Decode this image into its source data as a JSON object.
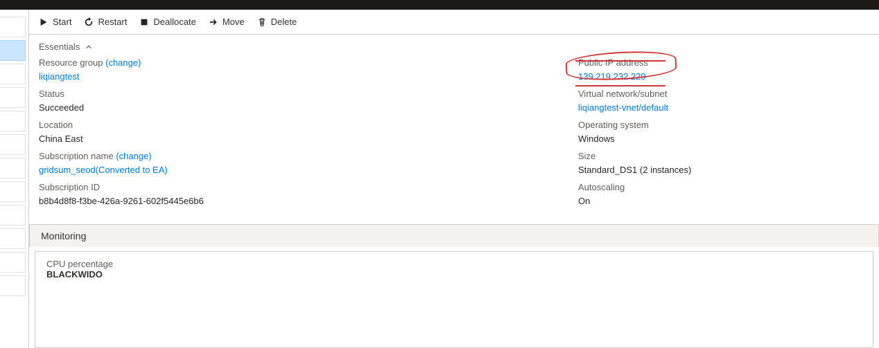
{
  "toolbar": {
    "start": "Start",
    "restart": "Restart",
    "deallocate": "Deallocate",
    "move": "Move",
    "delete": "Delete"
  },
  "essentials": {
    "header": "Essentials",
    "left": {
      "resource_group_label": "Resource group",
      "resource_group_change": "(change)",
      "resource_group_value": "liqiangtest",
      "status_label": "Status",
      "status_value": "Succeeded",
      "location_label": "Location",
      "location_value": "China East",
      "subscription_name_label": "Subscription name",
      "subscription_change": "(change)",
      "subscription_name_value": "gridsum_seod(Converted to EA)",
      "subscription_id_label": "Subscription ID",
      "subscription_id_value": "b8b4d8f8-f3be-426a-9261-602f5445e6b6"
    },
    "right": {
      "public_ip_label": "Public IP address",
      "public_ip_value": "139.219.232.229",
      "vnet_label": "Virtual network/subnet",
      "vnet_value": "liqiangtest-vnet/default",
      "os_label": "Operating system",
      "os_value": "Windows",
      "size_label": "Size",
      "size_value": "Standard_DS1 (2 instances)",
      "autoscaling_label": "Autoscaling",
      "autoscaling_value": "On"
    }
  },
  "monitoring": {
    "section": "Monitoring",
    "card_title": "CPU percentage",
    "card_sub": "BLACKWIDO"
  }
}
